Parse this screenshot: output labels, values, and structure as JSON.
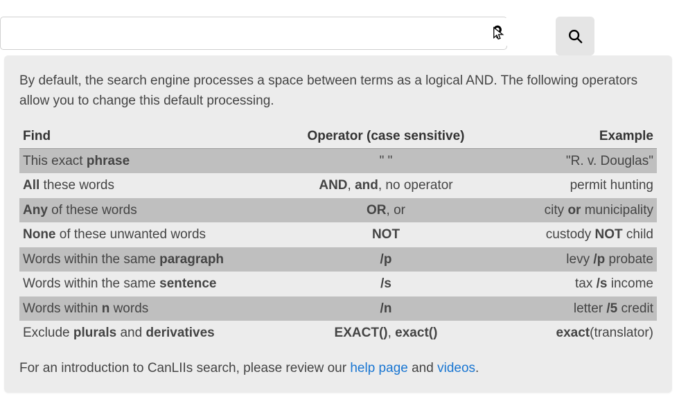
{
  "toolbar": {
    "searchPlaceholder": "",
    "helpIconName": "help",
    "searchIconName": "search"
  },
  "intro": "By default, the search engine processes a space between terms as a logical AND. The following operators allow you to change this default processing.",
  "headers": {
    "find": "Find",
    "operator": "Operator (case sensitive)",
    "example": "Example"
  },
  "rows": [
    {
      "shade": true,
      "findParts": [
        [
          "This exact ",
          false
        ],
        [
          "phrase",
          true
        ]
      ],
      "opParts": [
        [
          "\" \"",
          false
        ]
      ],
      "exParts": [
        [
          "\"R. v. Douglas\"",
          false
        ]
      ]
    },
    {
      "shade": false,
      "findParts": [
        [
          "All",
          true
        ],
        [
          " these words",
          false
        ]
      ],
      "opParts": [
        [
          "AND",
          true
        ],
        [
          ", ",
          false
        ],
        [
          "and",
          true
        ],
        [
          ", no operator",
          false
        ]
      ],
      "exParts": [
        [
          "permit hunting",
          false
        ]
      ]
    },
    {
      "shade": true,
      "findParts": [
        [
          "Any",
          true
        ],
        [
          " of these words",
          false
        ]
      ],
      "opParts": [
        [
          "OR",
          true
        ],
        [
          ", or",
          false
        ]
      ],
      "exParts": [
        [
          "city ",
          false
        ],
        [
          "or",
          true
        ],
        [
          " municipality",
          false
        ]
      ]
    },
    {
      "shade": false,
      "findParts": [
        [
          "None",
          true
        ],
        [
          " of these unwanted words",
          false
        ]
      ],
      "opParts": [
        [
          "NOT",
          true
        ]
      ],
      "exParts": [
        [
          "custody ",
          false
        ],
        [
          "NOT",
          true
        ],
        [
          " child",
          false
        ]
      ]
    },
    {
      "shade": true,
      "findParts": [
        [
          "Words within the same ",
          false
        ],
        [
          "paragraph",
          true
        ]
      ],
      "opParts": [
        [
          "/p",
          true
        ]
      ],
      "exParts": [
        [
          "levy ",
          false
        ],
        [
          "/p",
          true
        ],
        [
          " probate",
          false
        ]
      ]
    },
    {
      "shade": false,
      "findParts": [
        [
          "Words within the same ",
          false
        ],
        [
          "sentence",
          true
        ]
      ],
      "opParts": [
        [
          "/s",
          true
        ]
      ],
      "exParts": [
        [
          "tax ",
          false
        ],
        [
          "/s",
          true
        ],
        [
          " income",
          false
        ]
      ]
    },
    {
      "shade": true,
      "findParts": [
        [
          "Words within ",
          false
        ],
        [
          "n",
          true
        ],
        [
          " words",
          false
        ]
      ],
      "opParts": [
        [
          "/n",
          true
        ]
      ],
      "exParts": [
        [
          "letter ",
          false
        ],
        [
          "/5",
          true
        ],
        [
          " credit",
          false
        ]
      ]
    },
    {
      "shade": false,
      "findParts": [
        [
          "Exclude ",
          false
        ],
        [
          "plurals",
          true
        ],
        [
          " and ",
          false
        ],
        [
          "derivatives",
          true
        ]
      ],
      "opParts": [
        [
          "EXACT()",
          true
        ],
        [
          ", ",
          false
        ],
        [
          "exact()",
          true
        ]
      ],
      "exParts": [
        [
          "exact",
          true
        ],
        [
          "(translator)",
          false
        ]
      ]
    }
  ],
  "footer": {
    "prefix": "For an introduction to CanLIIs search, please review our ",
    "link1": "help page",
    "middle": " and ",
    "link2": "videos",
    "suffix": "."
  }
}
